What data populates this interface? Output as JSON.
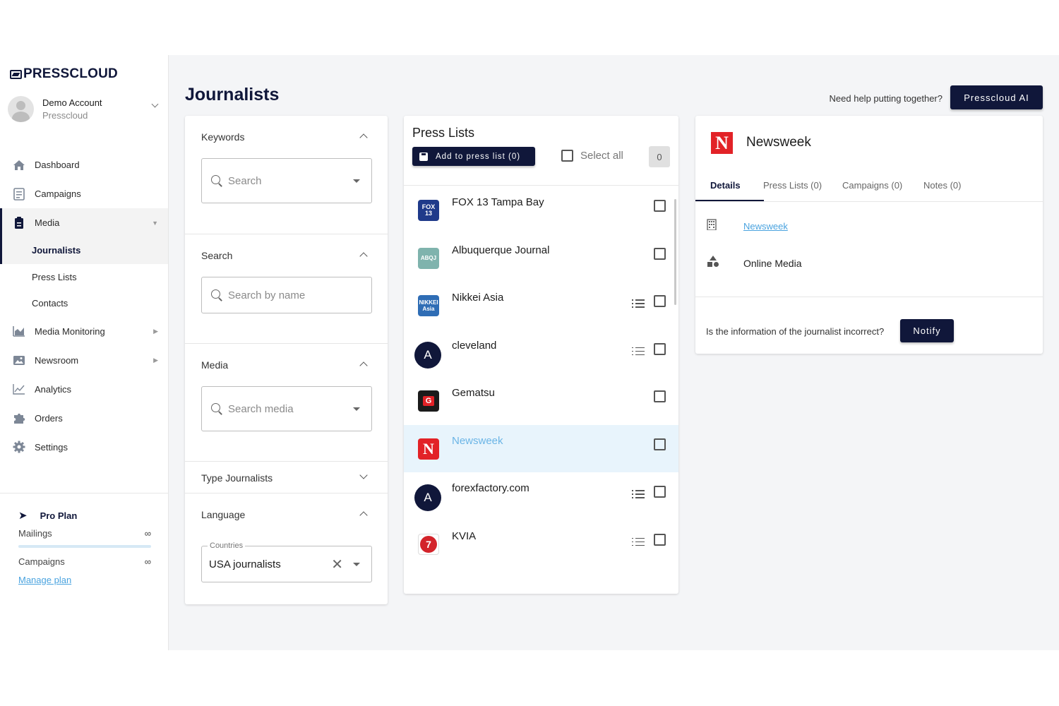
{
  "brand": {
    "logo_text": "PRESSCLOUD",
    "accent": "#10173a",
    "link": "#4aa3df"
  },
  "account": {
    "name": "Demo Account",
    "org": "Presscloud"
  },
  "nav": {
    "items": [
      {
        "label": "Dashboard",
        "icon": "home-icon"
      },
      {
        "label": "Campaigns",
        "icon": "document-icon"
      },
      {
        "label": "Media",
        "icon": "clipboard-icon"
      },
      {
        "label": "Media Monitoring",
        "icon": "chart-area-icon"
      },
      {
        "label": "Newsroom",
        "icon": "image-icon"
      },
      {
        "label": "Analytics",
        "icon": "line-chart-icon"
      },
      {
        "label": "Orders",
        "icon": "puzzle-icon"
      },
      {
        "label": "Settings",
        "icon": "gear-icon"
      }
    ],
    "media_sub": [
      "Journalists",
      "Press Lists",
      "Contacts"
    ]
  },
  "plan": {
    "name": "Pro Plan",
    "mailings_label": "Mailings",
    "mailings_value": "∞",
    "campaigns_label": "Campaigns",
    "campaigns_value": "∞",
    "manage_link": "Manage plan"
  },
  "header": {
    "title": "Journalists",
    "help_text": "Need help putting together?",
    "ai_button": "Presscloud AI"
  },
  "filters": {
    "keywords": {
      "label": "Keywords",
      "placeholder": "Search"
    },
    "search": {
      "label": "Search",
      "placeholder": "Search by name"
    },
    "media": {
      "label": "Media",
      "placeholder": "Search media"
    },
    "type": {
      "label": "Type Journalists"
    },
    "language": {
      "label": "Language",
      "field_label": "Countries",
      "value": "USA journalists"
    }
  },
  "press_lists": {
    "title": "Press Lists",
    "add_button": "Add to press list (0)",
    "select_all": "Select all",
    "count": "0",
    "rows": [
      {
        "name": "FOX 13 Tampa Bay",
        "logo": "FOX 13",
        "list_icon": false
      },
      {
        "name": "Albuquerque Journal",
        "logo": "ABQJ",
        "list_icon": false
      },
      {
        "name": "Nikkei Asia",
        "logo": "NIKKEI Asia",
        "list_icon": true
      },
      {
        "name": "cleveland",
        "logo": "A",
        "list_icon": true
      },
      {
        "name": "Gematsu",
        "logo": "G",
        "list_icon": false
      },
      {
        "name": "Newsweek",
        "logo": "N",
        "list_icon": false,
        "highlighted": true
      },
      {
        "name": "forexfactory.com",
        "logo": "A",
        "list_icon": true
      },
      {
        "name": "KVIA",
        "logo": "7",
        "list_icon": true
      }
    ]
  },
  "detail": {
    "name": "Newsweek",
    "logo": "N",
    "tabs": [
      "Details",
      "Press Lists (0)",
      "Campaigns (0)",
      "Notes (0)"
    ],
    "website_link": "Newsweek",
    "media_type": "Online Media",
    "incorrect_text": "Is the information of the journalist incorrect?",
    "notify_button": "Notify"
  }
}
